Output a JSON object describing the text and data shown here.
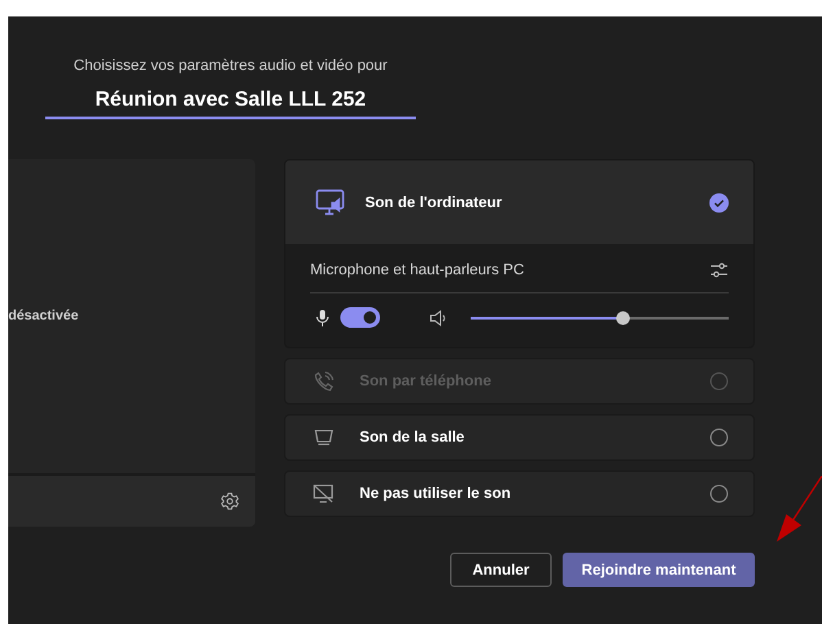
{
  "heading": "Choisissez vos paramètres audio et vidéo pour",
  "meeting_title": {
    "value": "Réunion avec Salle LLL 252"
  },
  "video_panel": {
    "status": "désactivée"
  },
  "audio_options": [
    {
      "kind": "computer",
      "label": "Son de l'ordinateur",
      "selected": true,
      "disabled": false
    },
    {
      "kind": "phone",
      "label": "Son par téléphone",
      "selected": false,
      "disabled": true
    },
    {
      "kind": "room",
      "label": "Son de la salle",
      "selected": false,
      "disabled": false
    },
    {
      "kind": "none",
      "label": "Ne pas utiliser le son",
      "selected": false,
      "disabled": false
    }
  ],
  "computer_audio": {
    "device": "Microphone et haut-parleurs PC",
    "microphone_on": true,
    "volume": {
      "level": 0.59
    }
  },
  "buttons": [
    {
      "kind": "secondary",
      "label": "Annuler"
    },
    {
      "kind": "primary",
      "label": "Rejoindre maintenant"
    }
  ]
}
